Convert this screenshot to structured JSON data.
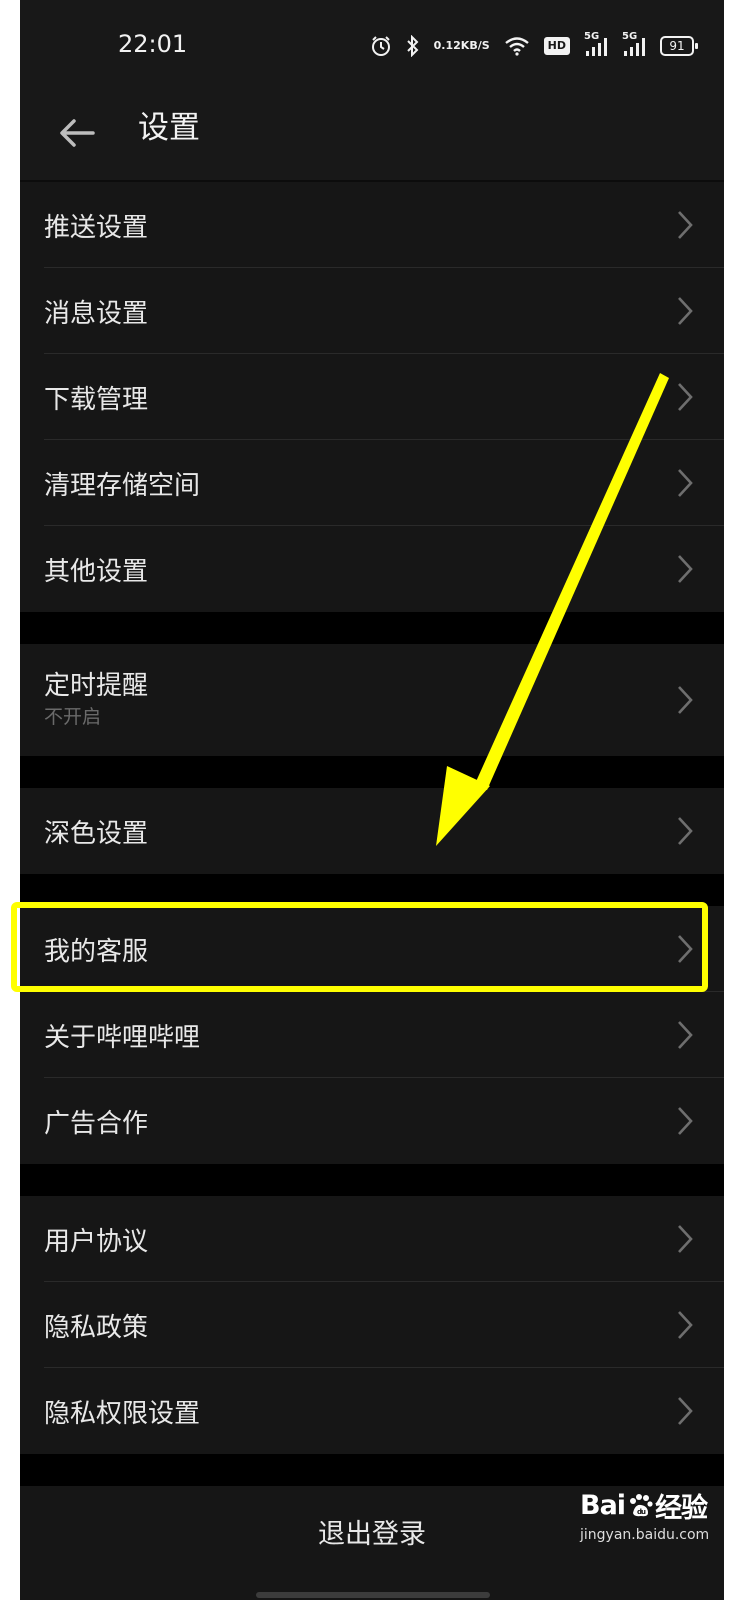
{
  "status_bar": {
    "time": "22:01",
    "speed_value": "0.12",
    "speed_unit": "KB/S",
    "hd_badge": "HD",
    "signal1_label": "5G",
    "signal2_label": "5G",
    "battery": "91",
    "icons": [
      "alarm-icon",
      "bluetooth-icon",
      "wifi-icon",
      "signal-icon",
      "battery-icon"
    ]
  },
  "header": {
    "title": "设置",
    "back_icon": "back-arrow-icon"
  },
  "groups": {
    "group1": [
      {
        "label": "推送设置"
      },
      {
        "label": "消息设置"
      },
      {
        "label": "下载管理"
      },
      {
        "label": "清理存储空间"
      },
      {
        "label": "其他设置"
      }
    ],
    "group2": [
      {
        "label": "定时提醒",
        "sub": "不开启"
      }
    ],
    "group3": [
      {
        "label": "深色设置"
      }
    ],
    "group4": [
      {
        "label": "我的客服"
      },
      {
        "label": "关于哔哩哔哩"
      },
      {
        "label": "广告合作"
      }
    ],
    "group5": [
      {
        "label": "用户协议"
      },
      {
        "label": "隐私政策"
      },
      {
        "label": "隐私权限设置"
      }
    ]
  },
  "logout": {
    "label": "退出登录"
  },
  "watermark": {
    "logo_left": "Bai",
    "logo_right": "经验",
    "url": "jingyan.baidu.com"
  },
  "annotation": {
    "color": "#ffff00"
  },
  "colors": {
    "background": "#000000",
    "row_background": "#161616",
    "header_background": "#181818",
    "text": "#e8e8e8",
    "subtext": "#6a6a6a",
    "chevron": "#6e6e6e"
  }
}
